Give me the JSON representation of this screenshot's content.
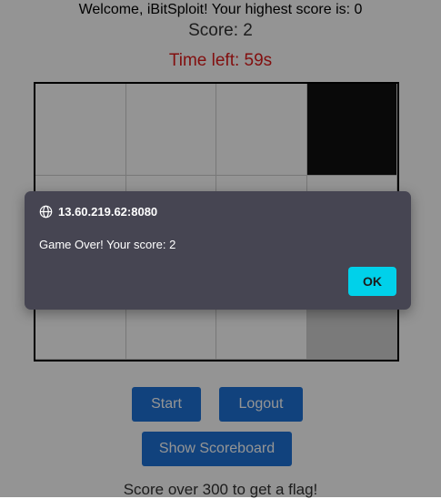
{
  "header": {
    "welcome": "Welcome, iBitSploit! Your highest score is: 0",
    "score": "Score: 2",
    "time_left": "Time left: 59s"
  },
  "board": {
    "columns": 4,
    "rows": [
      [
        "white",
        "white",
        "white",
        "black"
      ],
      [
        "white",
        "white",
        "white",
        "white"
      ],
      [
        "white",
        "white",
        "white",
        "gray"
      ]
    ]
  },
  "buttons": {
    "start": "Start",
    "logout": "Logout",
    "scoreboard": "Show Scoreboard"
  },
  "footer": {
    "hint": "Score over 300 to get a flag!"
  },
  "dialog": {
    "origin": "13.60.219.62:8080",
    "message": "Game Over! Your score: 2",
    "ok": "OK"
  },
  "colors": {
    "timer": "#e01b1b",
    "button": "#1e73d8",
    "dialog_bg": "#464552",
    "ok_button": "#00d1ea"
  }
}
